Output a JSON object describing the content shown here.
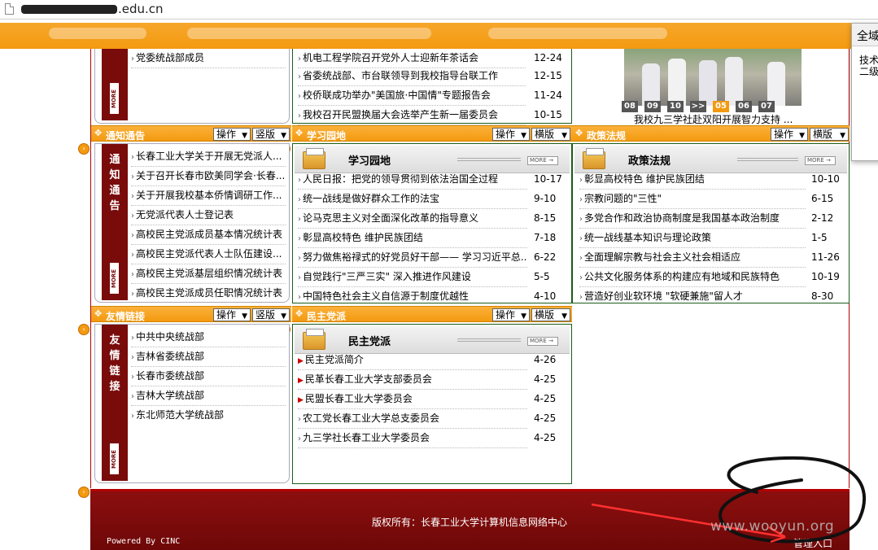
{
  "browser": {
    "url_visible": ".edu.cn"
  },
  "popup": {
    "title": "全域",
    "line1": "技术",
    "line2": "二级"
  },
  "top": {
    "left_item": "党委统战部成员",
    "news": [
      {
        "title": "机电工程学院召开党外人士迎新年茶话会",
        "date": "12-24"
      },
      {
        "title": "省委统战部、市台联领导到我校指导台联工作",
        "date": "12-15"
      },
      {
        "title": "校侨联成功举办\"美国旅·中国情\"专题报告会",
        "date": "11-24"
      },
      {
        "title": "我校召开民盟换届大会选举产生新一届委员会",
        "date": "10-15"
      }
    ],
    "slideshow": {
      "pages": [
        "08",
        "09",
        "10",
        ">>",
        "05",
        "06",
        "07"
      ],
      "active_index": 4,
      "caption": "我校九三学社赴双阳开展智力支持 ..."
    }
  },
  "controls": {
    "operate": "操作",
    "vertical": "竖版",
    "horizontal": "横版"
  },
  "notice": {
    "title": "通知通告",
    "tab": "通知通告",
    "more": "MORE",
    "items": [
      "长春工业大学关于开展无党派人...",
      "关于召开长春市欧美同学会·长春...",
      "关于开展我校基本侨情调研工作...",
      "无党派代表人士登记表",
      "高校民主党派成员基本情况统计表",
      "高校民主党派代表人士队伍建设...",
      "高校民主党派基层组织情况统计表",
      "高校民主党派成员任职情况统计表"
    ]
  },
  "study": {
    "title": "学习园地",
    "heading": "学习园地",
    "more": "MORE",
    "items": [
      {
        "title": "人民日报：把党的领导贯彻到依法治国全过程",
        "date": "10-17"
      },
      {
        "title": "统一战线是做好群众工作的法宝",
        "date": "9-10"
      },
      {
        "title": "论马克思主义对全面深化改革的指导意义",
        "date": "8-15"
      },
      {
        "title": "彰显高校特色 维护民族团结",
        "date": "7-18"
      },
      {
        "title": "努力做焦裕禄式的好党员好干部—— 学习习近平总...",
        "date": "6-22"
      },
      {
        "title": "自觉践行\"三严三实\" 深入推进作风建设",
        "date": "5-5"
      },
      {
        "title": "中国特色社会主义自信源于制度优越性",
        "date": "4-10"
      }
    ]
  },
  "policy": {
    "title": "政策法规",
    "heading": "政策法规",
    "more": "MORE",
    "items": [
      {
        "title": "彰显高校特色 维护民族团结",
        "date": "10-10"
      },
      {
        "title": "宗教问题的\"三性\"",
        "date": "6-15"
      },
      {
        "title": "多党合作和政治协商制度是我国基本政治制度",
        "date": "2-12"
      },
      {
        "title": "统一战线基本知识与理论政策",
        "date": "1-5"
      },
      {
        "title": "全面理解宗教与社会主义社会相适应",
        "date": "11-26"
      },
      {
        "title": "公共文化服务体系的构建应有地域和民族特色",
        "date": "10-19"
      },
      {
        "title": "营造好创业软环境 \"软硬兼施\"留人才",
        "date": "8-30"
      }
    ]
  },
  "links": {
    "title": "友情链接",
    "tab": "友情链接",
    "more": "MORE",
    "items": [
      "中共中央统战部",
      "吉林省委统战部",
      "长春市委统战部",
      "吉林大学统战部",
      "东北师范大学统战部"
    ]
  },
  "parties": {
    "title": "民主党派",
    "heading": "民主党派",
    "more": "MORE",
    "items": [
      {
        "title": "民主党派简介",
        "date": "4-26"
      },
      {
        "title": "民革长春工业大学支部委员会",
        "date": "4-25"
      },
      {
        "title": "民盟长春工业大学委员会",
        "date": "4-25"
      },
      {
        "title": "农工党长春工业大学总支委员会",
        "date": "4-25"
      },
      {
        "title": "九三学社长春工业大学委员会",
        "date": "4-25"
      }
    ]
  },
  "footer": {
    "copyright": "版权所有：长春工业大学计算机信息网络中心",
    "powered": "Powered By CINC",
    "admin": "管理入口"
  },
  "watermark": "www.wooyun.org"
}
